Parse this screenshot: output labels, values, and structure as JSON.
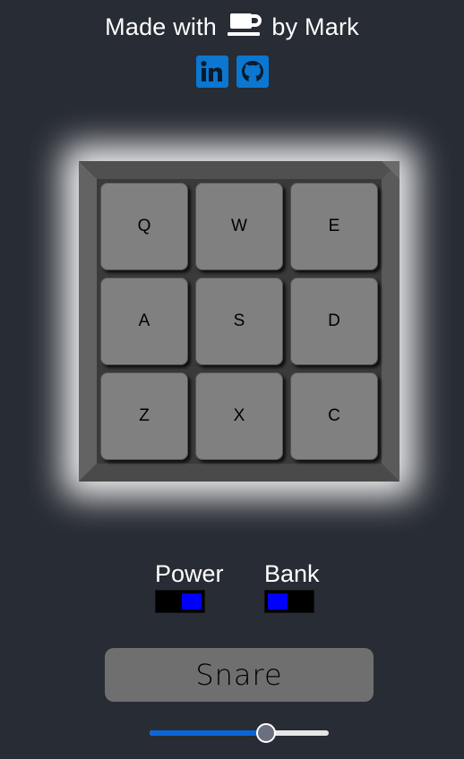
{
  "credit": {
    "prefix": "Made with",
    "suffix": "by Mark",
    "icon": "coffee-cup-icon"
  },
  "social": {
    "linkedin_icon": "linkedin-icon",
    "github_icon": "github-icon",
    "accent": "#0b77d0"
  },
  "pads": [
    {
      "key": "Q"
    },
    {
      "key": "W"
    },
    {
      "key": "E"
    },
    {
      "key": "A"
    },
    {
      "key": "S"
    },
    {
      "key": "D"
    },
    {
      "key": "Z"
    },
    {
      "key": "X"
    },
    {
      "key": "C"
    }
  ],
  "controls": {
    "power_label": "Power",
    "power_on": true,
    "bank_label": "Bank",
    "bank_on": false,
    "toggle_color": "#0000ff"
  },
  "display": {
    "text": "Snare"
  },
  "volume": {
    "value": 0.67
  },
  "colors": {
    "background": "#282c34",
    "pad": "#808080",
    "glow": "#ffffff"
  }
}
